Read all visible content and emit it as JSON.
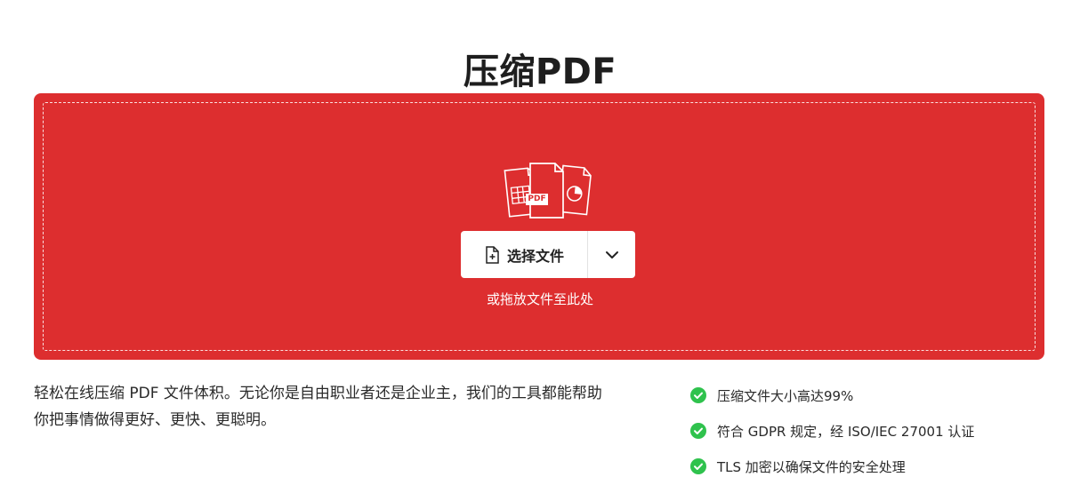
{
  "page": {
    "title": "压缩PDF"
  },
  "dropzone": {
    "select_button_label": "选择文件",
    "drop_hint": "或拖放文件至此处",
    "pdf_badge": "PDF",
    "background_color": "#dd2e2f",
    "icons": {
      "file_stack": "file-stack-icon",
      "select": "file-add-icon",
      "dropdown": "chevron-down-icon"
    }
  },
  "description": {
    "text": "轻松在线压缩 PDF 文件体积。无论你是自由职业者还是企业主，我们的工具都能帮助你把事情做得更好、更快、更聪明。"
  },
  "features": [
    {
      "label": "压缩文件大小高达99%",
      "icon": "check-circle-icon"
    },
    {
      "label": "符合 GDPR 规定，经 ISO/IEC 27001 认证",
      "icon": "check-circle-icon"
    },
    {
      "label": "TLS 加密以确保文件的安全处理",
      "icon": "check-circle-icon"
    }
  ],
  "colors": {
    "accent_red": "#dd2e2f",
    "check_green": "#2fc24d"
  }
}
